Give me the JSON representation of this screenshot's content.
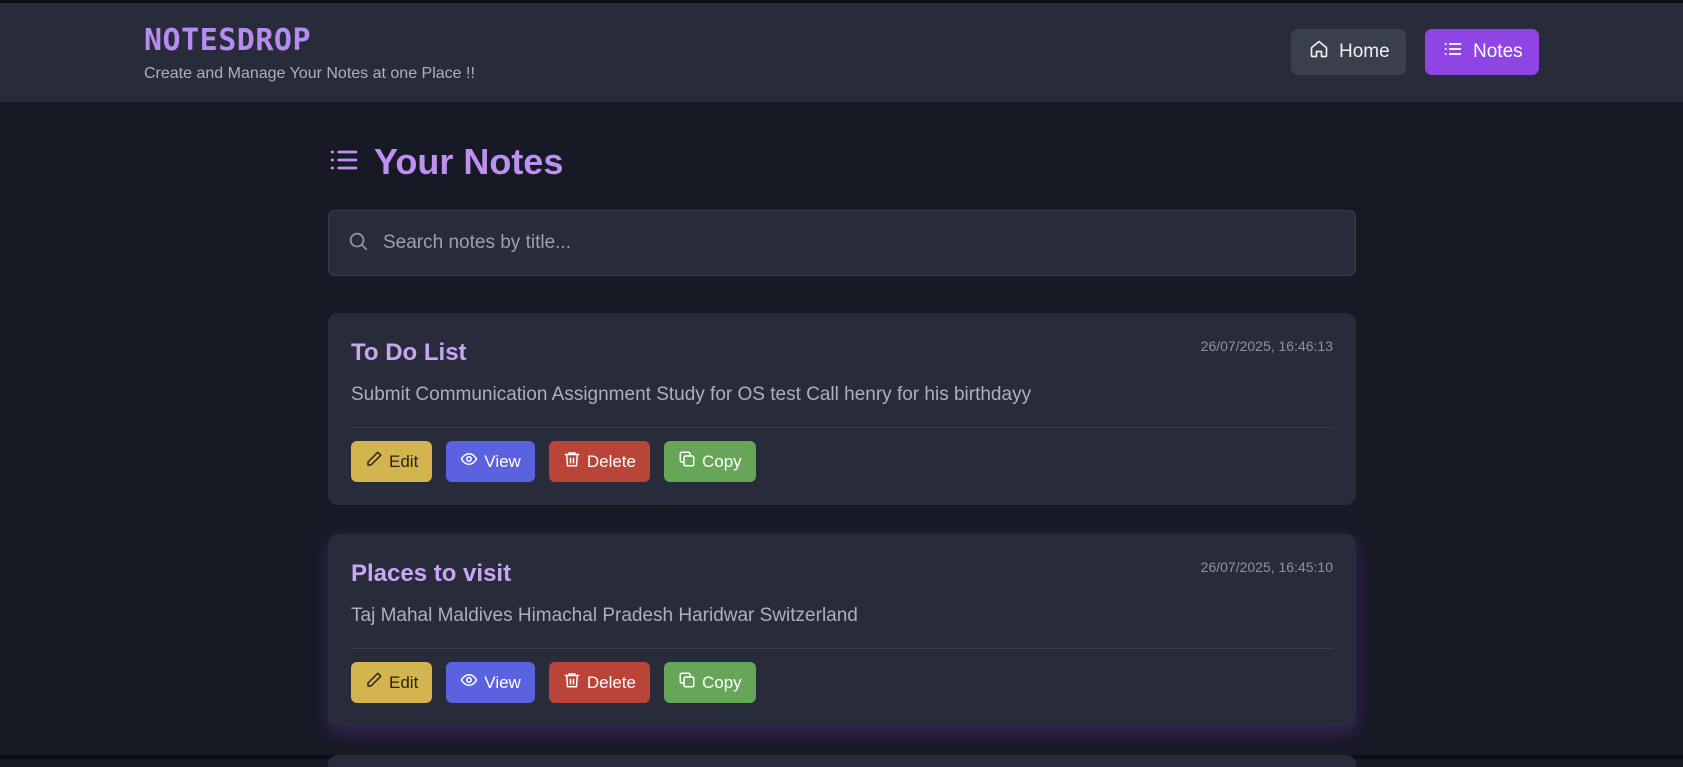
{
  "app": {
    "brand": "NOTESDROP",
    "tagline": "Create and Manage Your Notes at one Place !!"
  },
  "nav": {
    "home_label": "Home",
    "notes_label": "Notes"
  },
  "page": {
    "title": "Your Notes"
  },
  "search": {
    "placeholder": "Search notes by title...",
    "value": ""
  },
  "actions": {
    "edit": "Edit",
    "view": "View",
    "delete": "Delete",
    "copy": "Copy"
  },
  "notes": [
    {
      "title": "To Do List",
      "date": "26/07/2025, 16:46:13",
      "content": "Submit Communication Assignment Study for OS test Call henry for his birthdayy"
    },
    {
      "title": "Places to visit",
      "date": "26/07/2025, 16:45:10",
      "content": "Taj Mahal Maldives Himachal Pradesh Haridwar Switzerland"
    }
  ],
  "colors": {
    "background": "#171925",
    "header": "#282c3a",
    "accent": "#8f45e3",
    "title": "#bf8ff2",
    "edit": "#d4b44e",
    "view": "#5a62e0",
    "delete": "#bb4438",
    "copy": "#67a659"
  },
  "icons": {
    "home": "home-icon",
    "notes": "list-icon",
    "search": "search-icon",
    "edit": "pencil-icon",
    "view": "eye-icon",
    "delete": "trash-icon",
    "copy": "copy-icon"
  }
}
